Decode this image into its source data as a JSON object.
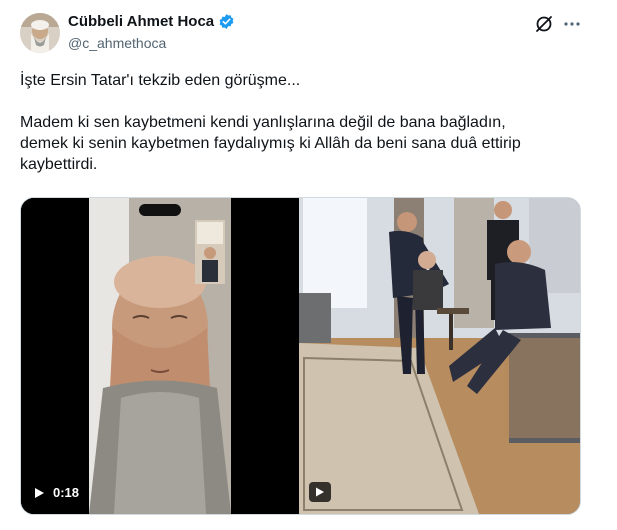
{
  "author": {
    "display_name": "Cübbeli Ahmet Hoca",
    "handle": "@c_ahmethoca",
    "avatar_icon": "profile-photo",
    "verified_icon": "verified-badge-icon",
    "verified_color": "#1d9bf0"
  },
  "header_icons": [
    "grok-icon",
    "more-icon"
  ],
  "tweet": {
    "line1": "İşte Ersin Tatar'ı tekzib eden görüşme...",
    "line2": "Madem ki sen kaybetmeni kendi yanlışlarına değil de bana bağladın,",
    "line3": "demek ki senin kaybetmen faydalıymış ki Allâh da beni sana duâ ettirip",
    "line4": "kaybettirdi."
  },
  "media": {
    "video_left": {
      "duration": "0:18",
      "play_icon": "play-icon"
    },
    "video_right": {
      "play_icon": "play-badge-icon"
    }
  }
}
